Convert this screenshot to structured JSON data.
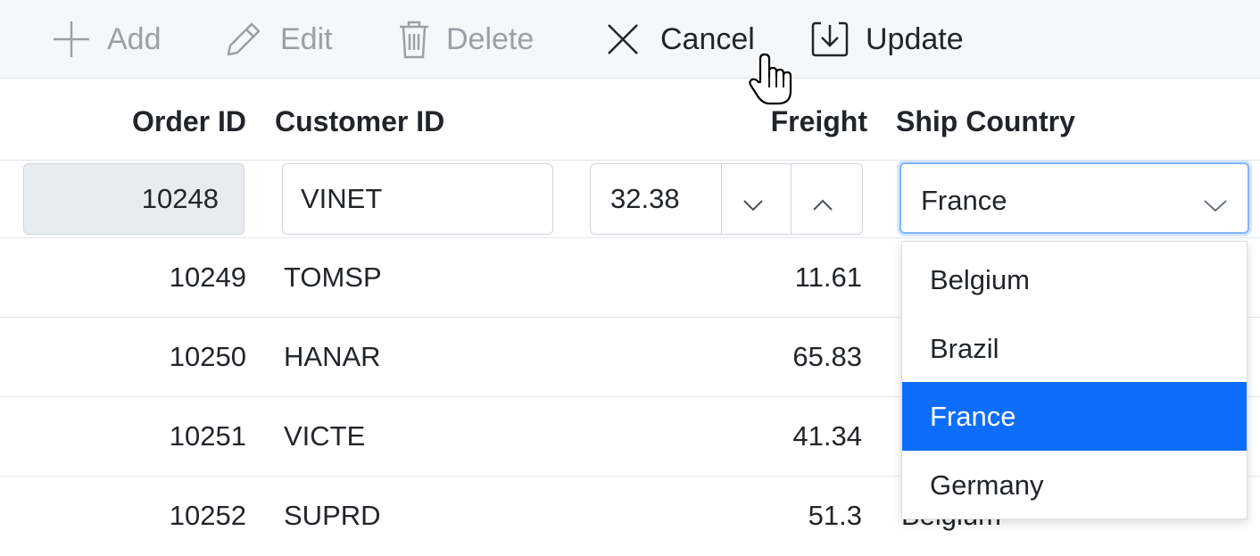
{
  "toolbar": {
    "add_label": "Add",
    "edit_label": "Edit",
    "delete_label": "Delete",
    "cancel_label": "Cancel",
    "update_label": "Update",
    "disabled_color": "#9aa0a6",
    "enabled_color": "#212529"
  },
  "columns": {
    "order_id": "Order ID",
    "customer_id": "Customer ID",
    "freight": "Freight",
    "ship_country": "Ship Country"
  },
  "edit_row": {
    "order_id": "10248",
    "customer_id": "VINET",
    "freight": "32.38",
    "ship_country": "France"
  },
  "rows": [
    {
      "order_id": "10249",
      "customer_id": "TOMSP",
      "freight": "11.61",
      "ship_country": ""
    },
    {
      "order_id": "10250",
      "customer_id": "HANAR",
      "freight": "65.83",
      "ship_country": ""
    },
    {
      "order_id": "10251",
      "customer_id": "VICTE",
      "freight": "41.34",
      "ship_country": ""
    },
    {
      "order_id": "10252",
      "customer_id": "SUPRD",
      "freight": "51.3",
      "ship_country": "Belgium"
    }
  ],
  "dropdown": {
    "options": [
      "Belgium",
      "Brazil",
      "France",
      "Germany"
    ],
    "selected": "France",
    "selected_color": "#0d6efd"
  },
  "icons": {
    "add": "plus-icon",
    "edit": "pencil-icon",
    "delete": "trash-icon",
    "cancel": "close-icon",
    "update": "save-icon",
    "spin_down": "chevron-down-icon",
    "spin_up": "chevron-up-icon",
    "dropdown": "chevron-down-icon",
    "cursor": "hand-pointer-icon"
  }
}
